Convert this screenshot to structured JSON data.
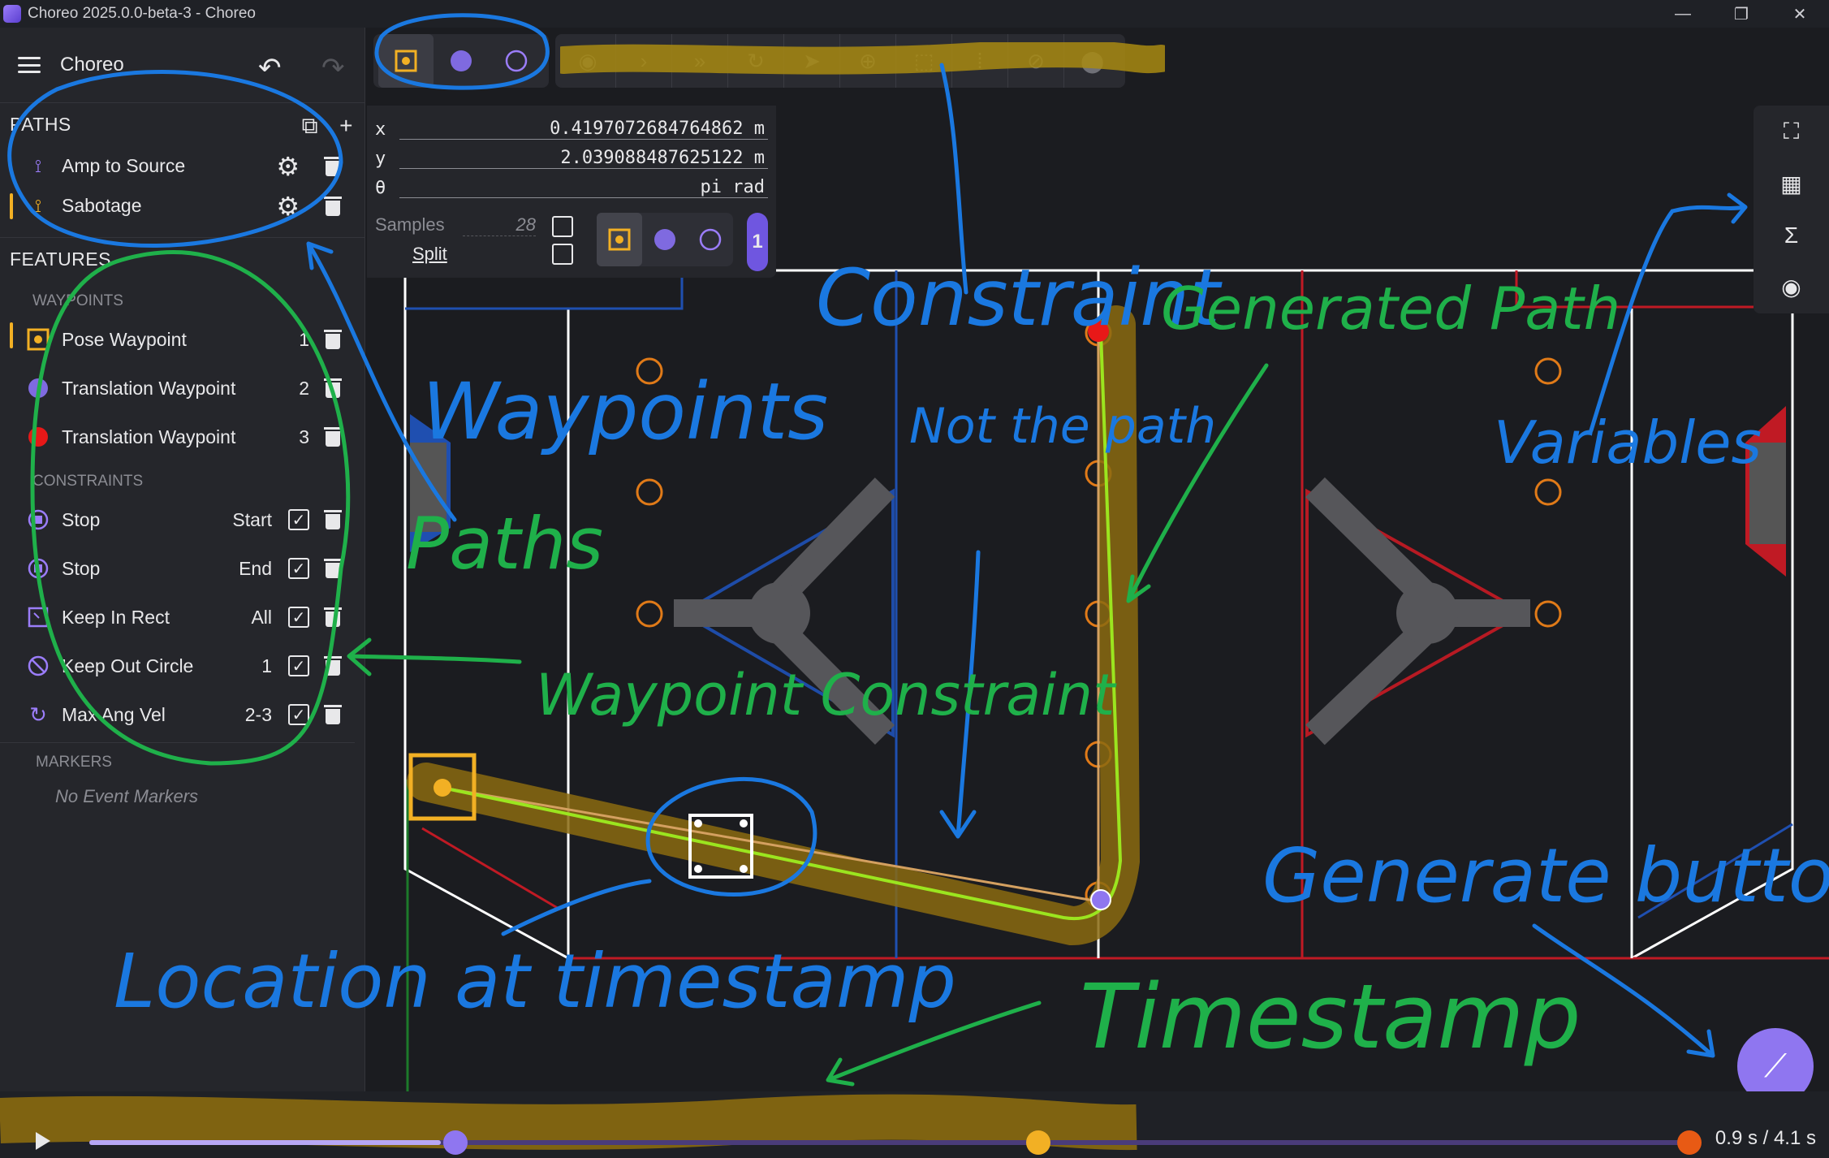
{
  "window": {
    "title": "Choreo 2025.0.0-beta-3 - Choreo",
    "minimize": "—",
    "maximize": "❐",
    "close": "✕"
  },
  "sidebar": {
    "app_name": "Choreo",
    "paths_title": "PATHS",
    "paths": [
      {
        "label": "Amp to Source",
        "selected": false
      },
      {
        "label": "Sabotage",
        "selected": true
      }
    ],
    "features_title": "FEATURES",
    "waypoints_title": "WAYPOINTS",
    "waypoints": [
      {
        "label": "Pose Waypoint",
        "index": "1",
        "icon": "pose-waypoint-icon"
      },
      {
        "label": "Translation Waypoint",
        "index": "2",
        "icon": "translation-waypoint-icon"
      },
      {
        "label": "Translation Waypoint",
        "index": "3",
        "icon": "translation-waypoint-icon"
      }
    ],
    "constraints_title": "CONSTRAINTS",
    "constraints": [
      {
        "label": "Stop",
        "scope": "Start",
        "icon": "stop-icon"
      },
      {
        "label": "Stop",
        "scope": "End",
        "icon": "stop-icon"
      },
      {
        "label": "Keep In Rect",
        "scope": "All",
        "icon": "keep-in-rect-icon"
      },
      {
        "label": "Keep Out Circle",
        "scope": "1",
        "icon": "keep-out-circle-icon"
      },
      {
        "label": "Max Ang Vel",
        "scope": "2-3",
        "icon": "max-ang-vel-icon"
      }
    ],
    "markers_title": "MARKERS",
    "no_markers": "No Event Markers"
  },
  "properties": {
    "x_label": "x",
    "x_value": "0.419707268476486​2 m",
    "y_label": "y",
    "y_value": "2.039088487625122 m",
    "theta_label": "θ",
    "theta_value": "pi rad",
    "samples_label": "Samples",
    "samples_value": "28",
    "split_label": "Split",
    "waypoint_number": "1"
  },
  "timeline": {
    "time_text": "0.9 s / 4.1 s",
    "progress": 0.22
  },
  "annotations": {
    "paths": "Paths",
    "waypoints": "Waypoints",
    "constraint": "Constraint",
    "generated_path": "Generated Path",
    "not_the_path": "Not the path",
    "variables": "Variables",
    "waypoint_constraint": "Waypoint Constraint",
    "location": "Location at timestamp",
    "timestamp": "Timestamp",
    "generate_button": "Generate button"
  },
  "colors": {
    "accent": "#f2b024",
    "purple": "#8f76f0",
    "blue_alliance": "#1f4fb0",
    "red_alliance": "#c01a24",
    "annotation_blue": "#1a78e0",
    "annotation_green": "#1fb04a",
    "path_green": "#9be51f"
  }
}
